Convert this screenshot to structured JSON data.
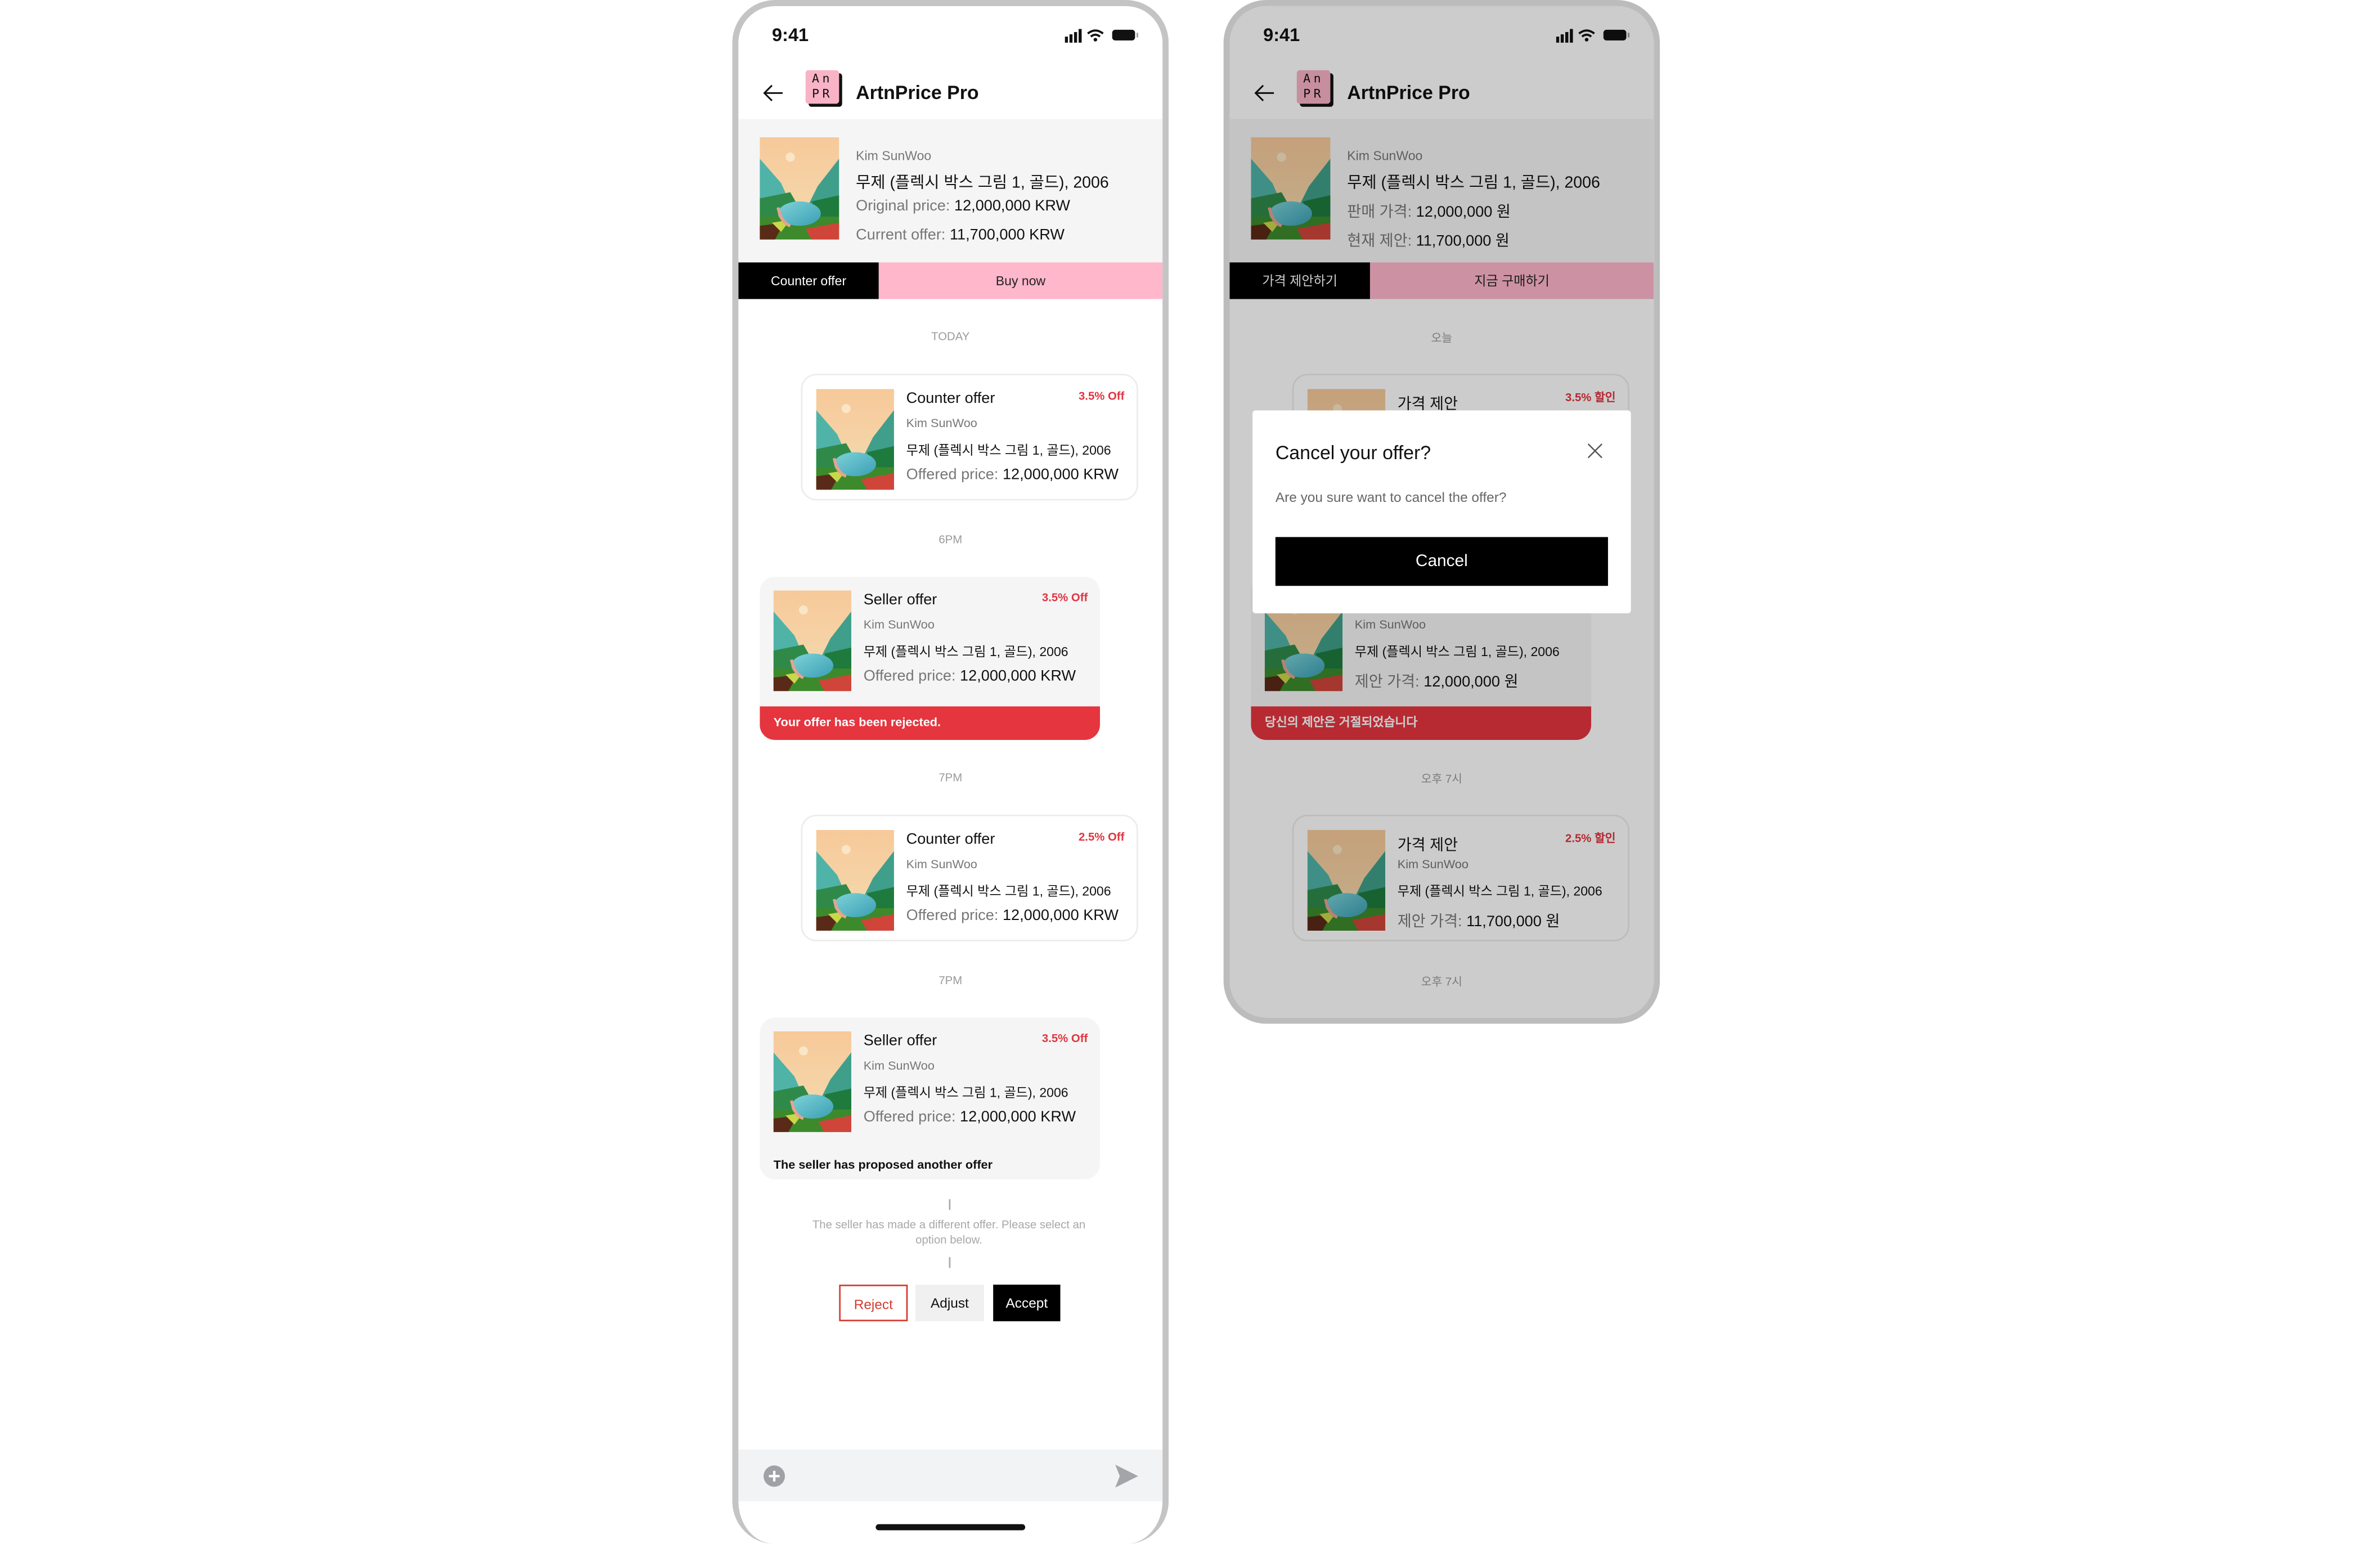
{
  "colors": {
    "accent_pink": "#ffb7cc",
    "discount_red": "#e0343f",
    "reject_banner": "#e5353f",
    "primary": "#000000"
  },
  "left": {
    "status_time": "9:41",
    "header": {
      "title": "ArtnPrice Pro",
      "logo_text": "AnPR",
      "back_icon": "arrow-left-icon"
    },
    "product": {
      "artist": "Kim SunWoo",
      "title": "무제 (플렉시 박스 그림 1, 골드), 2006",
      "original_label": "Original price:",
      "original_value": "12,000,000 KRW",
      "current_label": "Current offer:",
      "current_value": "11,700,000 KRW"
    },
    "actions": {
      "counter": "Counter offer",
      "buy": "Buy now"
    },
    "stamps": [
      "TODAY",
      "6PM",
      "7PM",
      "7PM"
    ],
    "cards": [
      {
        "type": "Counter offer",
        "off": "3.5% Off",
        "artist": "Kim SunWoo",
        "name": "무제 (플렉시 박스 그림 1, 골드), 2006",
        "price_label": "Offered price:",
        "price": "12,000,000 KRW"
      },
      {
        "type": "Seller offer",
        "off": "3.5% Off",
        "artist": "Kim SunWoo",
        "name": "무제 (플렉시 박스 그림 1, 골드), 2006",
        "price_label": "Offered price:",
        "price": "12,000,000 KRW",
        "banner": "Your offer has been rejected."
      },
      {
        "type": "Counter offer",
        "off": "2.5% Off",
        "artist": "Kim SunWoo",
        "name": "무제 (플렉시 박스 그림 1, 골드), 2006",
        "price_label": "Offered price:",
        "price": "12,000,000 KRW"
      },
      {
        "type": "Seller offer",
        "off": "3.5% Off",
        "artist": "Kim SunWoo",
        "name": "무제 (플렉시 박스 그림 1, 골드), 2006",
        "price_label": "Offered price:",
        "price": "12,000,000 KRW",
        "footer": "The seller has proposed another offer"
      }
    ],
    "note_line1": "The seller has made a different offer. Please select an",
    "note_line2": "option below.",
    "decision": {
      "reject": "Reject",
      "adjust": "Adjust",
      "accept": "Accept"
    }
  },
  "right": {
    "status_time": "9:41",
    "header": {
      "title": "ArtnPrice Pro",
      "logo_text": "AnPR"
    },
    "product": {
      "artist": "Kim SunWoo",
      "title": "무제 (플렉시 박스 그림 1, 골드), 2006",
      "original_label": "판매 가격:",
      "original_value": "12,000,000 원",
      "current_label": "현재 제안:",
      "current_value": "11,700,000 원"
    },
    "actions": {
      "counter": "가격 제안하기",
      "buy": "지금 구매하기"
    },
    "stamps": [
      "오늘",
      "오후 7시",
      "오후 7시"
    ],
    "cards": [
      {
        "type": "가격 제안",
        "off": "3.5% 할인"
      },
      {
        "artist": "Kim SunWoo",
        "name": "무제 (플렉시 박스 그림 1, 골드), 2006",
        "price_label": "제안 가격:",
        "price": "12,000,000 원",
        "banner": "당신의 제안은 거절되었습니다"
      },
      {
        "type": "가격 제안",
        "off": "2.5% 할인",
        "artist": "Kim SunWoo",
        "name": "무제 (플렉시 박스 그림 1, 골드), 2006",
        "price_label": "제안 가격:",
        "price": "11,700,000 원"
      }
    ],
    "modal": {
      "title": "Cancel your offer?",
      "body": "Are you sure want to cancel the offer?",
      "button": "Cancel"
    }
  }
}
